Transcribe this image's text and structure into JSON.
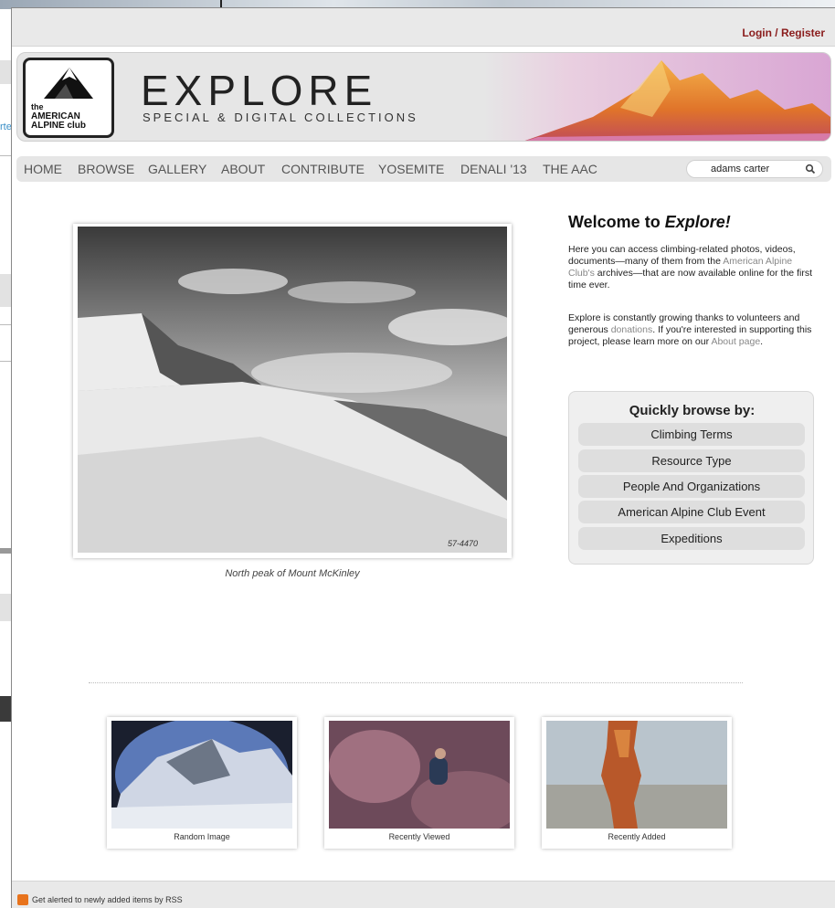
{
  "header": {
    "login_label": "Login / Register"
  },
  "banner": {
    "logo_text": [
      "the",
      "AMERICAN",
      "ALPINE club"
    ],
    "title": "EXPLORE",
    "subtitle": "SPECIAL & DIGITAL COLLECTIONS"
  },
  "nav": {
    "items": [
      "HOME",
      "BROWSE",
      "GALLERY",
      "ABOUT",
      "CONTRIBUTE",
      "YOSEMITE",
      "DENALI '13",
      "THE AAC"
    ],
    "search_value": "adams carter"
  },
  "feature": {
    "caption": "North peak of Mount McKinley",
    "photo_mark": "57-4470"
  },
  "welcome": {
    "title_prefix": "Welcome to ",
    "title_em": "Explore!",
    "p1_a": "Here you can access climbing-related photos, videos, documents—many of them from the ",
    "p1_link": "American Alpine Club's",
    "p1_b": " archives—that are now available online for the first time ever.",
    "p2_a": "Explore is constantly growing thanks to volunteers and generous ",
    "p2_link": "donations",
    "p2_b": ". If you're interested in supporting this project, please learn more on our ",
    "p2_link2": "About page",
    "p2_c": "."
  },
  "browse": {
    "title": "Quickly browse by:",
    "items": [
      "Climbing Terms",
      "Resource Type",
      "People And Organizations",
      "American Alpine Club Event",
      "Expeditions"
    ]
  },
  "thumbs": [
    "Random Image",
    "Recently Viewed",
    "Recently Added"
  ],
  "footer": {
    "rss_label": "Get alerted to newly added items by RSS"
  },
  "background_window": {
    "partial_link": "rte"
  },
  "colors": {
    "login": "#8a1c1c",
    "link_gray": "#888888",
    "rss": "#e8731c"
  }
}
